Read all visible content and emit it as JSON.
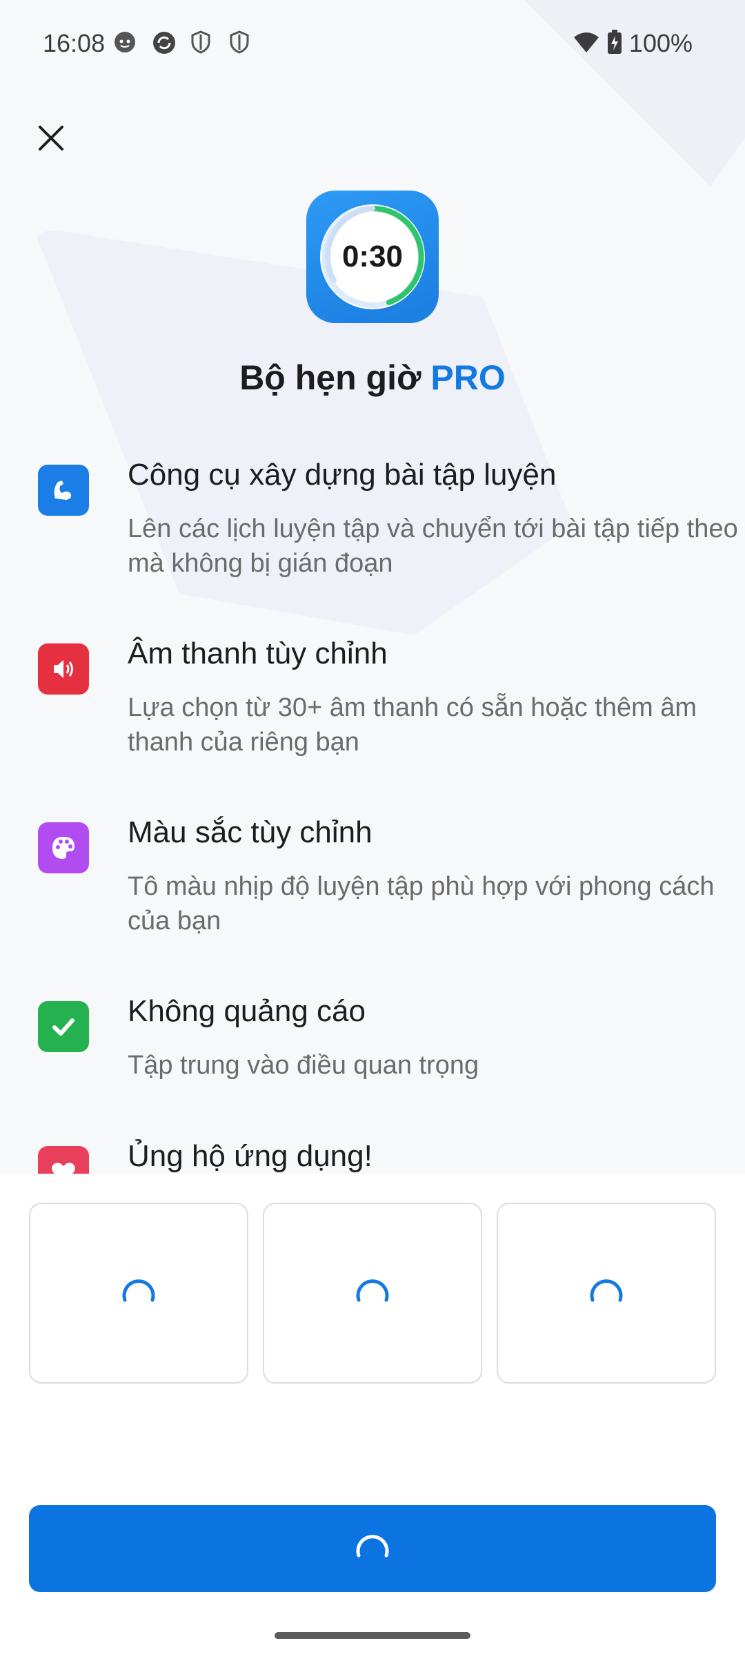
{
  "status_bar": {
    "time": "16:08",
    "battery": "100%",
    "icons": [
      "face-icon",
      "sync-icon",
      "shield-icon",
      "shield-icon",
      "wifi-icon",
      "battery-charging-icon"
    ]
  },
  "app_icon": {
    "timer_text": "0:30"
  },
  "header": {
    "title_prefix": "Bộ hẹn giờ",
    "title_highlight": "PRO"
  },
  "features": [
    {
      "icon": "flexed-arm-icon",
      "color": "#1a7ee6",
      "title": "Công cụ xây dựng bài tập luyện",
      "desc": "Lên các lịch luyện tập và chuyển tới bài tập tiếp theo mà không bị gián đoạn"
    },
    {
      "icon": "speaker-icon",
      "color": "#e5303f",
      "title": "Âm thanh tùy chỉnh",
      "desc": "Lựa chọn từ 30+ âm thanh có sẵn hoặc thêm âm thanh của riêng bạn"
    },
    {
      "icon": "palette-icon",
      "color": "#b14cf0",
      "title": "Màu sắc tùy chỉnh",
      "desc": "Tô màu nhịp độ luyện tập phù hợp với phong cách của bạn"
    },
    {
      "icon": "checkmark-icon",
      "color": "#25b150",
      "title": "Không quảng cáo",
      "desc": "Tập trung vào điều quan trọng"
    },
    {
      "icon": "heart-icon",
      "color": "#e8405b",
      "title": "Ủng hộ ứng dụng!",
      "desc": ""
    }
  ],
  "colors": {
    "accent": "#1479e0",
    "button": "#0b74e0",
    "spinner": "#1479e0"
  }
}
